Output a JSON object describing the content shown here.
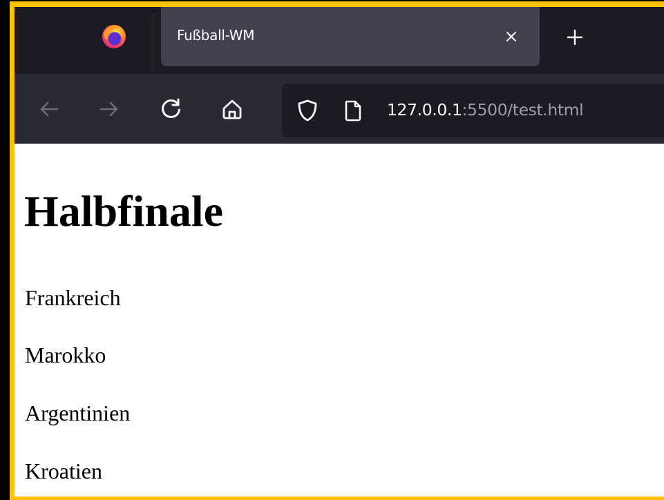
{
  "browser": {
    "tab": {
      "title": "Fußball-WM"
    },
    "urlbar": {
      "host": "127.0.0.1",
      "rest": ":5500/test.html"
    },
    "icons": {
      "logo": "firefox-logo",
      "close": "close-icon",
      "new_tab": "plus-icon",
      "back": "back-arrow-icon",
      "forward": "forward-arrow-icon",
      "reload": "reload-icon",
      "home": "home-icon",
      "tracking": "shield-icon",
      "page": "page-icon"
    },
    "colors": {
      "tabstrip": "#1c1b22",
      "selected_tab": "#42414d",
      "toolbar": "#2b2a33",
      "urlbar": "#1c1b22",
      "frame_border": "#ffc200"
    }
  },
  "page": {
    "heading": "Halbfinale",
    "teams": [
      "Frankreich",
      "Marokko",
      "Argentinien",
      "Kroatien"
    ]
  }
}
